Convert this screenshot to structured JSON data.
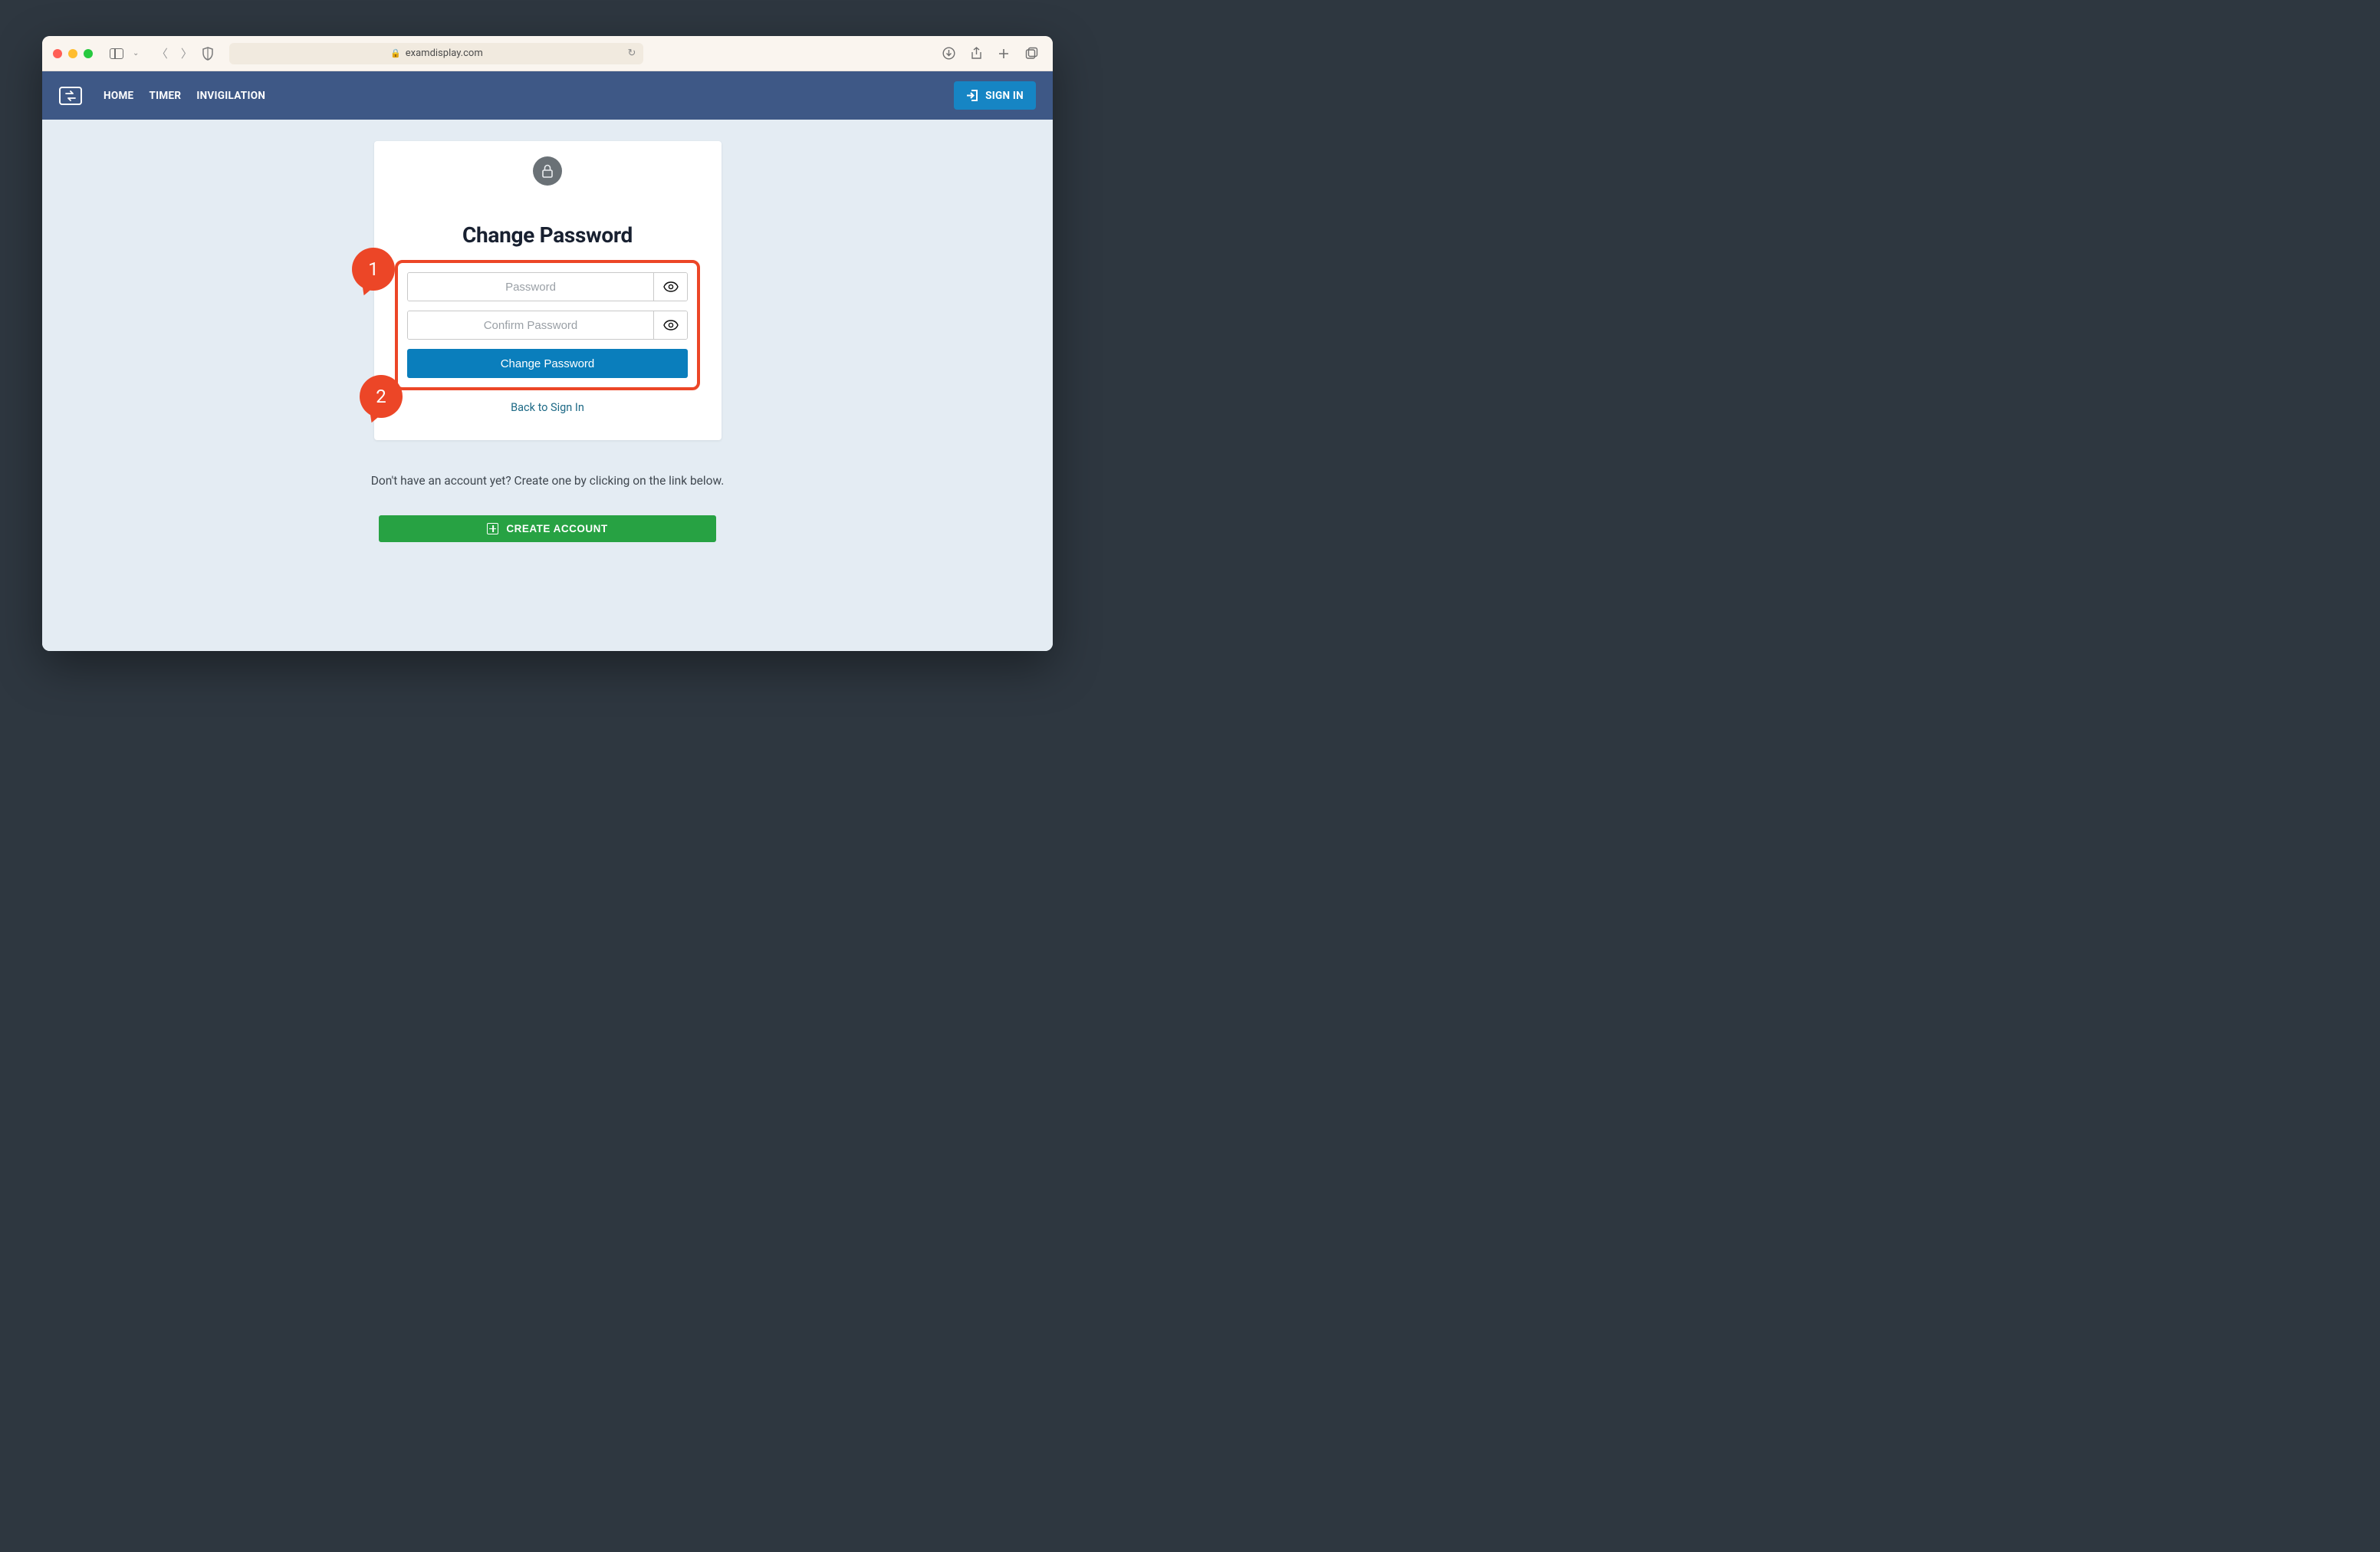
{
  "browser": {
    "url_host": "examdisplay.com"
  },
  "nav": {
    "links": [
      "HOME",
      "TIMER",
      "INVIGILATION"
    ],
    "sign_in_label": "SIGN IN"
  },
  "card": {
    "title": "Change Password",
    "password_placeholder": "Password",
    "confirm_password_placeholder": "Confirm Password",
    "submit_label": "Change Password",
    "back_link_label": "Back to Sign In"
  },
  "footer": {
    "no_account_text": "Don't have an account yet? Create one by clicking on the link below.",
    "create_account_label": "CREATE ACCOUNT"
  },
  "annotations": {
    "step1": "1",
    "step2": "2"
  }
}
